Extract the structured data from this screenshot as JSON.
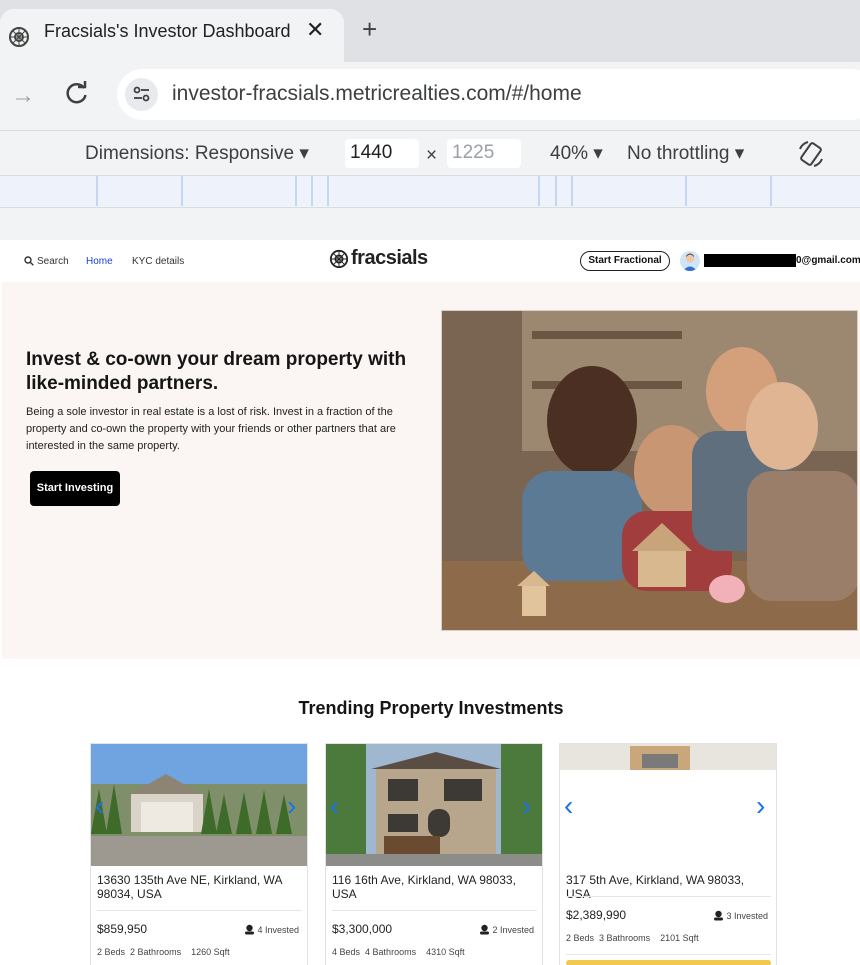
{
  "browser": {
    "tab_title": "Fracsials's Investor Dashboard",
    "tab_close": "✕",
    "new_tab": "+",
    "url": "investor-fracsials.metricrealties.com/#/home"
  },
  "devtools": {
    "dimensions_label": "Dimensions: Responsive",
    "width_value": "1440",
    "times": "×",
    "height_placeholder": "1225",
    "zoom": "40%",
    "throttling": "No throttling"
  },
  "header": {
    "search_label": "Search",
    "home_label": "Home",
    "kyc_label": "KYC details",
    "brand": "fracsials",
    "start_fractional_label": "Start Fractional",
    "email_suffix": "0@gmail.com"
  },
  "hero": {
    "title": "Invest & co-own your dream property with like-minded partners.",
    "description": "Being a sole investor in real estate is a lost of risk. Invest in a fraction of the property and co-own the property with your friends or other partners that are interested in the same property.",
    "cta_label": "Start Investing"
  },
  "trending": {
    "title": "Trending Property Investments",
    "cards": [
      {
        "address": "13630 135th Ave NE, Kirkland, WA 98034, USA",
        "price": "$859,950",
        "invested": "4 Invested",
        "beds": "2 Beds",
        "baths": "2 Bathrooms",
        "sqft": "1260 Sqft"
      },
      {
        "address": "116 16th Ave, Kirkland, WA 98033, USA",
        "price": "$3,300,000",
        "invested": "2 Invested",
        "beds": "4 Beds",
        "baths": "4 Bathrooms",
        "sqft": "4310 Sqft"
      },
      {
        "address": "317 5th Ave, Kirkland, WA 98033, USA",
        "price": "$2,389,990",
        "invested": "3 Invested",
        "beds": "2 Beds",
        "baths": "3 Bathrooms",
        "sqft": "2101 Sqft"
      }
    ]
  },
  "colors": {
    "link": "#1a3fd1",
    "accent_chevron": "#1a73e8",
    "hero_bg": "#fbf6f3"
  }
}
